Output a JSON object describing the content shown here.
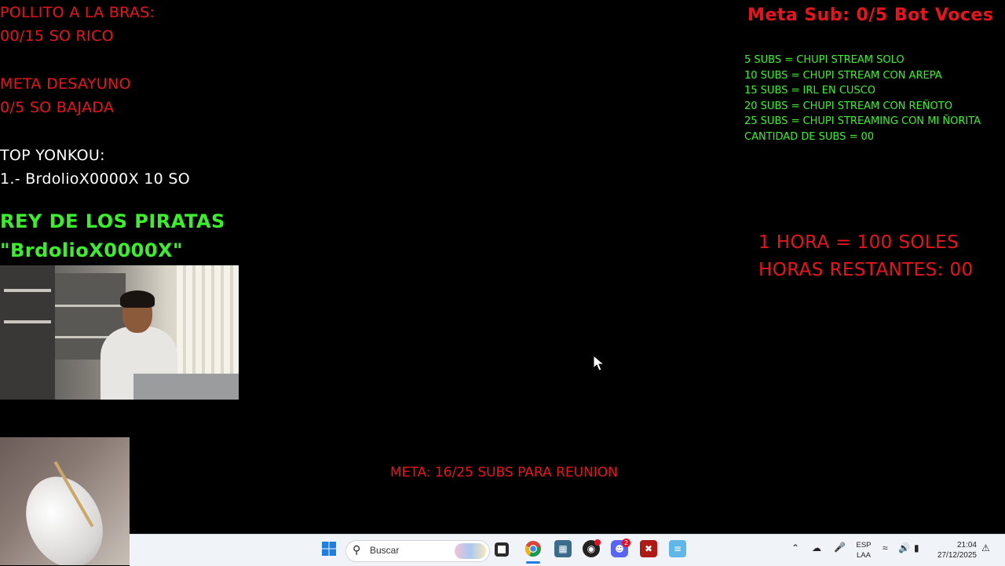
{
  "overlay_left": {
    "pollito_title": "POLLITO A LA BRAS:",
    "pollito_value": "00/15 SO RICO",
    "desayuno_title": "META DESAYUNO",
    "desayuno_value": "0/5 SO BAJADA",
    "top_title": "TOP YONKOU:",
    "top_entry": "1.- BrdolioX0000X 10 SO",
    "rey_title": "REY DE LOS PIRATAS",
    "rey_name": " \"BrdolioX0000X\""
  },
  "overlay_right": {
    "meta_sub": "Meta Sub: 0/5 Bot Voces",
    "sub_goals": [
      "5 SUBS = CHUPI STREAM SOLO",
      "10 SUBS = CHUPI STREAM CON AREPA",
      "15 SUBS = IRL EN CUSCO",
      "20 SUBS = CHUPI STREAM CON REÑOTO",
      "25 SUBS = CHUPI STREAMING CON MI ÑORITA",
      "CANTIDAD DE SUBS = 00"
    ],
    "hora_rate": "1 HORA = 100 SOLES",
    "horas_restantes": "HORAS RESTANTES: 00"
  },
  "overlay_center": {
    "meta_reunion": "META: 16/25 SUBS PARA REUNION"
  },
  "taskbar": {
    "search_placeholder": "Buscar",
    "lang_top": "ESP",
    "lang_bottom": "LAA",
    "time": "21:04",
    "date": "27/12/2025",
    "discord_badge": "2"
  },
  "colors": {
    "overlay_red": "#e8141c",
    "overlay_green": "#3af02a",
    "taskbar_bg": "#f0f3f8"
  }
}
